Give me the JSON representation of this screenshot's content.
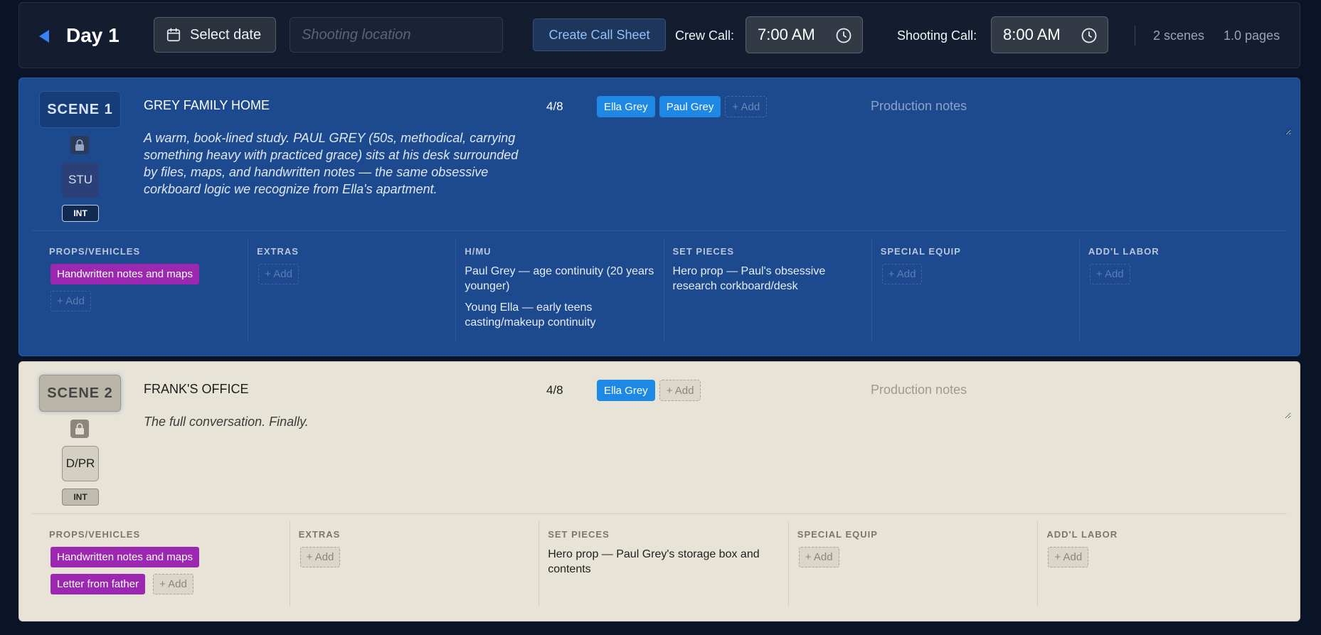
{
  "header": {
    "day_title": "Day 1",
    "select_date_label": "Select date",
    "location_placeholder": "Shooting location",
    "create_call_sheet_label": "Create Call Sheet",
    "crew_call_label": "Crew Call:",
    "crew_call_time": "7:00 AM",
    "shooting_call_label": "Shooting Call:",
    "shooting_call_time": "8:00 AM",
    "scene_count": "2 scenes",
    "page_count": "1.0 pages"
  },
  "colors": {
    "scene1_bg": "#1d4a8f",
    "scene2_bg": "#e7e3d6",
    "cast_chip": "#1e88e5",
    "prop_chip": "#9c27b0",
    "accent": "#3b82f6"
  },
  "icons": [
    "back-arrow-icon",
    "calendar-icon",
    "clock-icon",
    "lock-icon"
  ],
  "scenes": [
    {
      "badge": "SCENE 1",
      "set_code": "STU",
      "int_ext": "INT",
      "location": "GREY FAMILY HOME",
      "description": "A warm, book-lined study. PAUL GREY (50s, methodical, carrying something heavy with practiced grace) sits at his desk surrounded by files, maps, and handwritten notes — the same obsessive corkboard logic we recognize from Ella's apartment.",
      "page_length": "4/8",
      "cast": [
        "Ella Grey",
        "Paul Grey"
      ],
      "add_label": "+ Add",
      "notes_placeholder": "Production notes",
      "breakdown": {
        "props_label": "PROPS/VEHICLES",
        "props": [
          "Handwritten notes and maps"
        ],
        "extras_label": "EXTRAS",
        "hmu_label": "H/MU",
        "hmu": [
          "Paul Grey — age continuity (20 years younger)",
          "Young Ella — early teens casting/makeup continuity"
        ],
        "set_pieces_label": "SET PIECES",
        "set_pieces": [
          "Hero prop — Paul's obsessive research corkboard/desk"
        ],
        "special_equip_label": "SPECIAL EQUIP",
        "addl_labor_label": "ADD'L LABOR"
      }
    },
    {
      "badge": "SCENE 2",
      "set_code": "D/PR",
      "int_ext": "INT",
      "location": "FRANK'S OFFICE",
      "description": "The full conversation. Finally.",
      "page_length": "4/8",
      "cast": [
        "Ella Grey"
      ],
      "add_label": "+ Add",
      "notes_placeholder": "Production notes",
      "breakdown": {
        "props_label": "PROPS/VEHICLES",
        "props": [
          "Handwritten notes and maps",
          "Letter from father"
        ],
        "extras_label": "EXTRAS",
        "set_pieces_label": "SET PIECES",
        "set_pieces": [
          "Hero prop — Paul Grey's storage box and contents"
        ],
        "special_equip_label": "SPECIAL EQUIP",
        "addl_labor_label": "ADD'L LABOR"
      }
    }
  ]
}
